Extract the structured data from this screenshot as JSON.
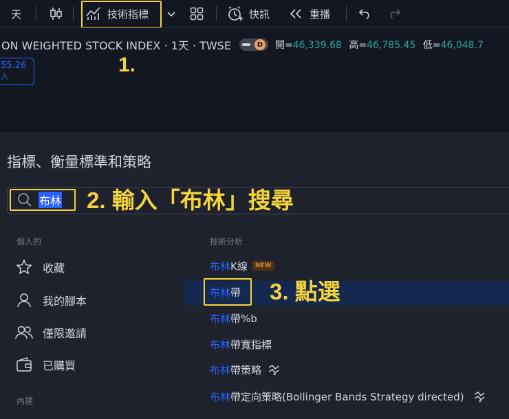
{
  "toolbar": {
    "interval": "天",
    "indicators_label": "技術指標",
    "alert_label": "快訊",
    "replay_label": "重播"
  },
  "chart": {
    "symbol": "ON WEIGHTED STOCK INDEX · 1天 · TWSE",
    "badge": "D",
    "ohlc": [
      {
        "key": "開=",
        "value": "46,339.68"
      },
      {
        "key": "高=",
        "value": "46,785.45"
      },
      {
        "key": "低=",
        "value": "46,048.7"
      }
    ],
    "price_tag": "55.26",
    "price_sub": "入"
  },
  "steps": {
    "step1": "1.",
    "step2": "2. 輸入「布林」搜尋",
    "step3": "3. 點選"
  },
  "dialog": {
    "title": "指標、衡量標準和策略",
    "search_value": "布林",
    "personal_heading": "個人的",
    "builtin_heading": "內建",
    "personal_items": [
      {
        "label": "收藏",
        "icon": "star-icon"
      },
      {
        "label": "我的腳本",
        "icon": "user-icon"
      },
      {
        "label": "僅限邀請",
        "icon": "users-icon"
      },
      {
        "label": "已購買",
        "icon": "wallet-icon"
      }
    ],
    "results_heading": "技術分析",
    "results": [
      {
        "match": "布林",
        "rest": "K線",
        "badge": "NEW"
      },
      {
        "match": "布林",
        "rest": "帶"
      },
      {
        "match": "布林",
        "rest": "帶%b"
      },
      {
        "match": "布林",
        "rest": "帶寬指標"
      },
      {
        "match": "布林",
        "rest": "帶策略",
        "icon": "strategy-icon"
      },
      {
        "match": "布林",
        "rest": "帶定向策略(Bollinger Bands Strategy directed)",
        "icon": "strategy-icon"
      }
    ]
  },
  "colors": {
    "highlight": "#f5d33a",
    "match": "#2962ff",
    "ohlc_value": "#26a69a"
  }
}
